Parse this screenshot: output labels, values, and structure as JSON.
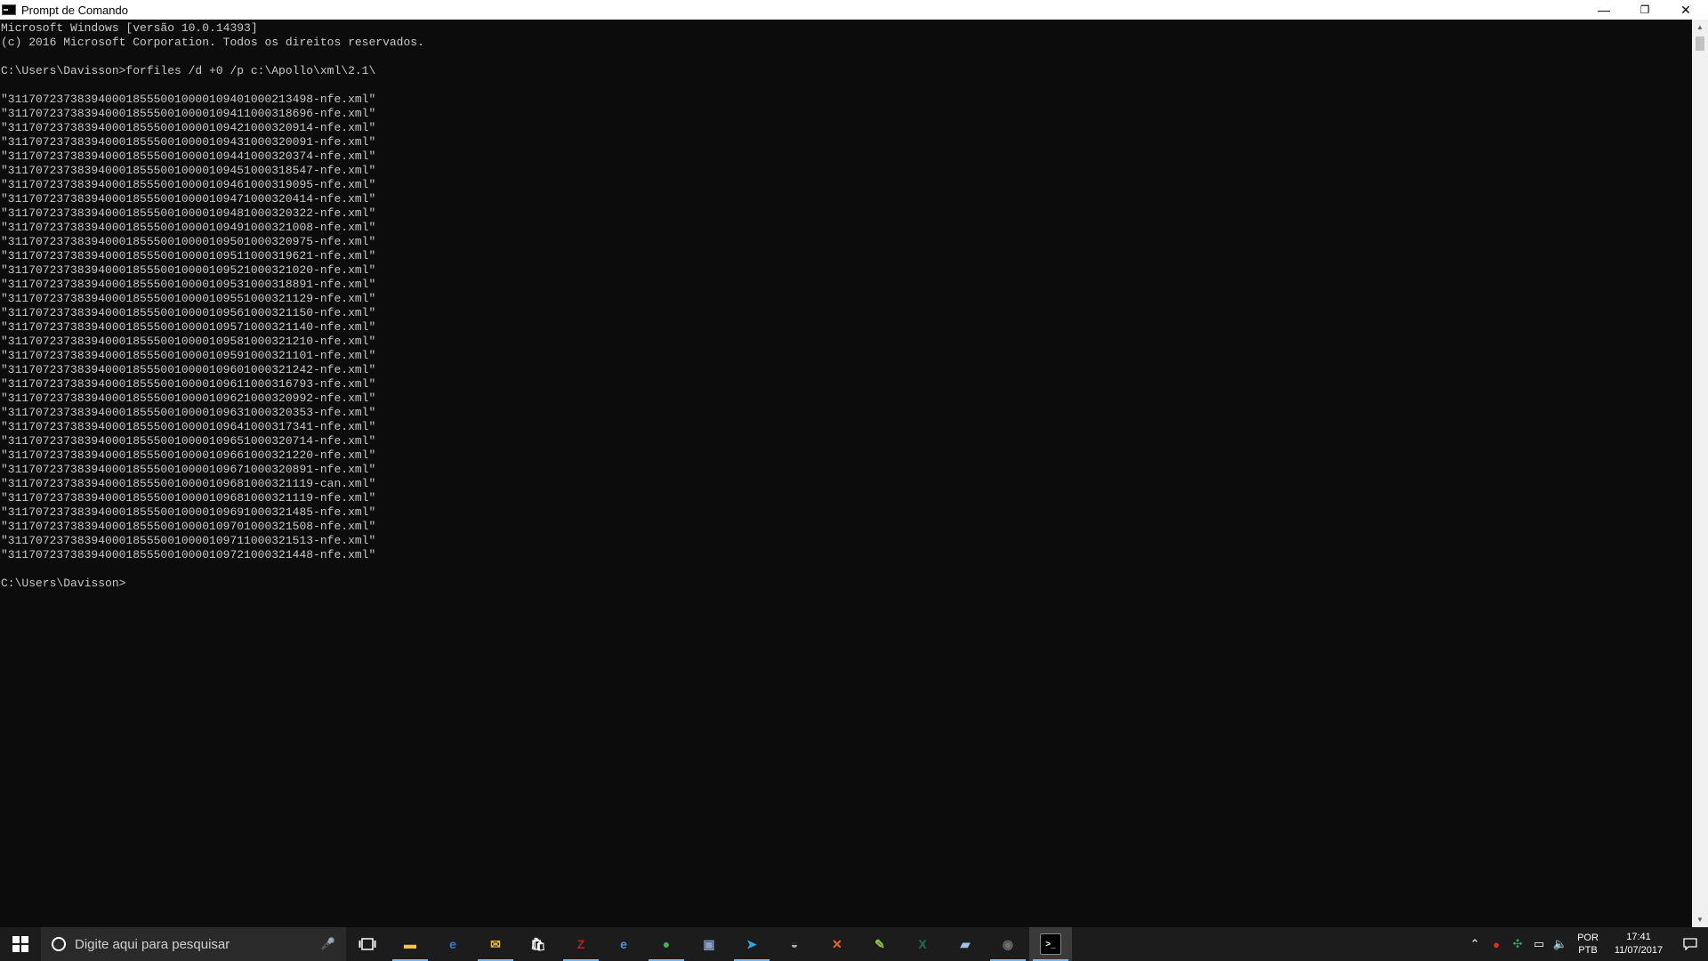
{
  "window": {
    "title": "Prompt de Comando",
    "minimize_glyph": "—",
    "restore_glyph": "❐",
    "close_glyph": "✕"
  },
  "console": {
    "lines": [
      "Microsoft Windows [versão 10.0.14393]",
      "(c) 2016 Microsoft Corporation. Todos os direitos reservados.",
      "",
      "C:\\Users\\Davisson>forfiles /d +0 /p c:\\Apollo\\xml\\2.1\\",
      "",
      "\"31170723738394000185550010000109401000213498-nfe.xml\"",
      "\"31170723738394000185550010000109411000318696-nfe.xml\"",
      "\"31170723738394000185550010000109421000320914-nfe.xml\"",
      "\"31170723738394000185550010000109431000320091-nfe.xml\"",
      "\"31170723738394000185550010000109441000320374-nfe.xml\"",
      "\"31170723738394000185550010000109451000318547-nfe.xml\"",
      "\"31170723738394000185550010000109461000319095-nfe.xml\"",
      "\"31170723738394000185550010000109471000320414-nfe.xml\"",
      "\"31170723738394000185550010000109481000320322-nfe.xml\"",
      "\"31170723738394000185550010000109491000321008-nfe.xml\"",
      "\"31170723738394000185550010000109501000320975-nfe.xml\"",
      "\"31170723738394000185550010000109511000319621-nfe.xml\"",
      "\"31170723738394000185550010000109521000321020-nfe.xml\"",
      "\"31170723738394000185550010000109531000318891-nfe.xml\"",
      "\"31170723738394000185550010000109551000321129-nfe.xml\"",
      "\"31170723738394000185550010000109561000321150-nfe.xml\"",
      "\"31170723738394000185550010000109571000321140-nfe.xml\"",
      "\"31170723738394000185550010000109581000321210-nfe.xml\"",
      "\"31170723738394000185550010000109591000321101-nfe.xml\"",
      "\"31170723738394000185550010000109601000321242-nfe.xml\"",
      "\"31170723738394000185550010000109611000316793-nfe.xml\"",
      "\"31170723738394000185550010000109621000320992-nfe.xml\"",
      "\"31170723738394000185550010000109631000320353-nfe.xml\"",
      "\"31170723738394000185550010000109641000317341-nfe.xml\"",
      "\"31170723738394000185550010000109651000320714-nfe.xml\"",
      "\"31170723738394000185550010000109661000321220-nfe.xml\"",
      "\"31170723738394000185550010000109671000320891-nfe.xml\"",
      "\"31170723738394000185550010000109681000321119-can.xml\"",
      "\"31170723738394000185550010000109681000321119-nfe.xml\"",
      "\"31170723738394000185550010000109691000321485-nfe.xml\"",
      "\"31170723738394000185550010000109701000321508-nfe.xml\"",
      "\"31170723738394000185550010000109711000321513-nfe.xml\"",
      "\"31170723738394000185550010000109721000321448-nfe.xml\"",
      "",
      "C:\\Users\\Davisson>"
    ]
  },
  "taskbar": {
    "search_placeholder": "Digite aqui para pesquisar",
    "apps": [
      {
        "name": "file-explorer-icon",
        "glyph": "▬",
        "color": "#f4c542",
        "running": true
      },
      {
        "name": "edge-icon",
        "glyph": "e",
        "color": "#2b7fd8",
        "running": false
      },
      {
        "name": "outlook-icon",
        "glyph": "✉",
        "color": "#e8b54a",
        "running": true
      },
      {
        "name": "store-icon",
        "glyph": "🛍",
        "color": "#ffffff",
        "running": false
      },
      {
        "name": "filezilla-icon",
        "glyph": "Z",
        "color": "#bf1e1e",
        "running": true
      },
      {
        "name": "internet-explorer-icon",
        "glyph": "e",
        "color": "#3f9ae6",
        "running": false
      },
      {
        "name": "chrome-icon",
        "glyph": "●",
        "color": "#4caf50",
        "running": true
      },
      {
        "name": "media-icon",
        "glyph": "▣",
        "color": "#8aa0c8",
        "running": false
      },
      {
        "name": "telegram-icon",
        "glyph": "➤",
        "color": "#2ea6e0",
        "running": true
      },
      {
        "name": "app-dome-icon",
        "glyph": "◒",
        "color": "#b0b0b0",
        "running": false
      },
      {
        "name": "xampp-icon",
        "glyph": "✕",
        "color": "#f26522",
        "running": false
      },
      {
        "name": "notepad-plus-icon",
        "glyph": "✎",
        "color": "#8bc34a",
        "running": false
      },
      {
        "name": "excel-icon",
        "glyph": "X",
        "color": "#1e7145",
        "running": false
      },
      {
        "name": "notes-icon",
        "glyph": "▰",
        "color": "#9ec3e6",
        "running": false
      },
      {
        "name": "obs-icon",
        "glyph": "◉",
        "color": "#6e6e6e",
        "running": true
      },
      {
        "name": "cmd-icon",
        "glyph": ">_",
        "color": "#000000",
        "running": true,
        "active": true
      }
    ],
    "tray": {
      "lang_top": "POR",
      "lang_bottom": "PTB",
      "time": "17:41",
      "date": "11/07/2017"
    }
  }
}
